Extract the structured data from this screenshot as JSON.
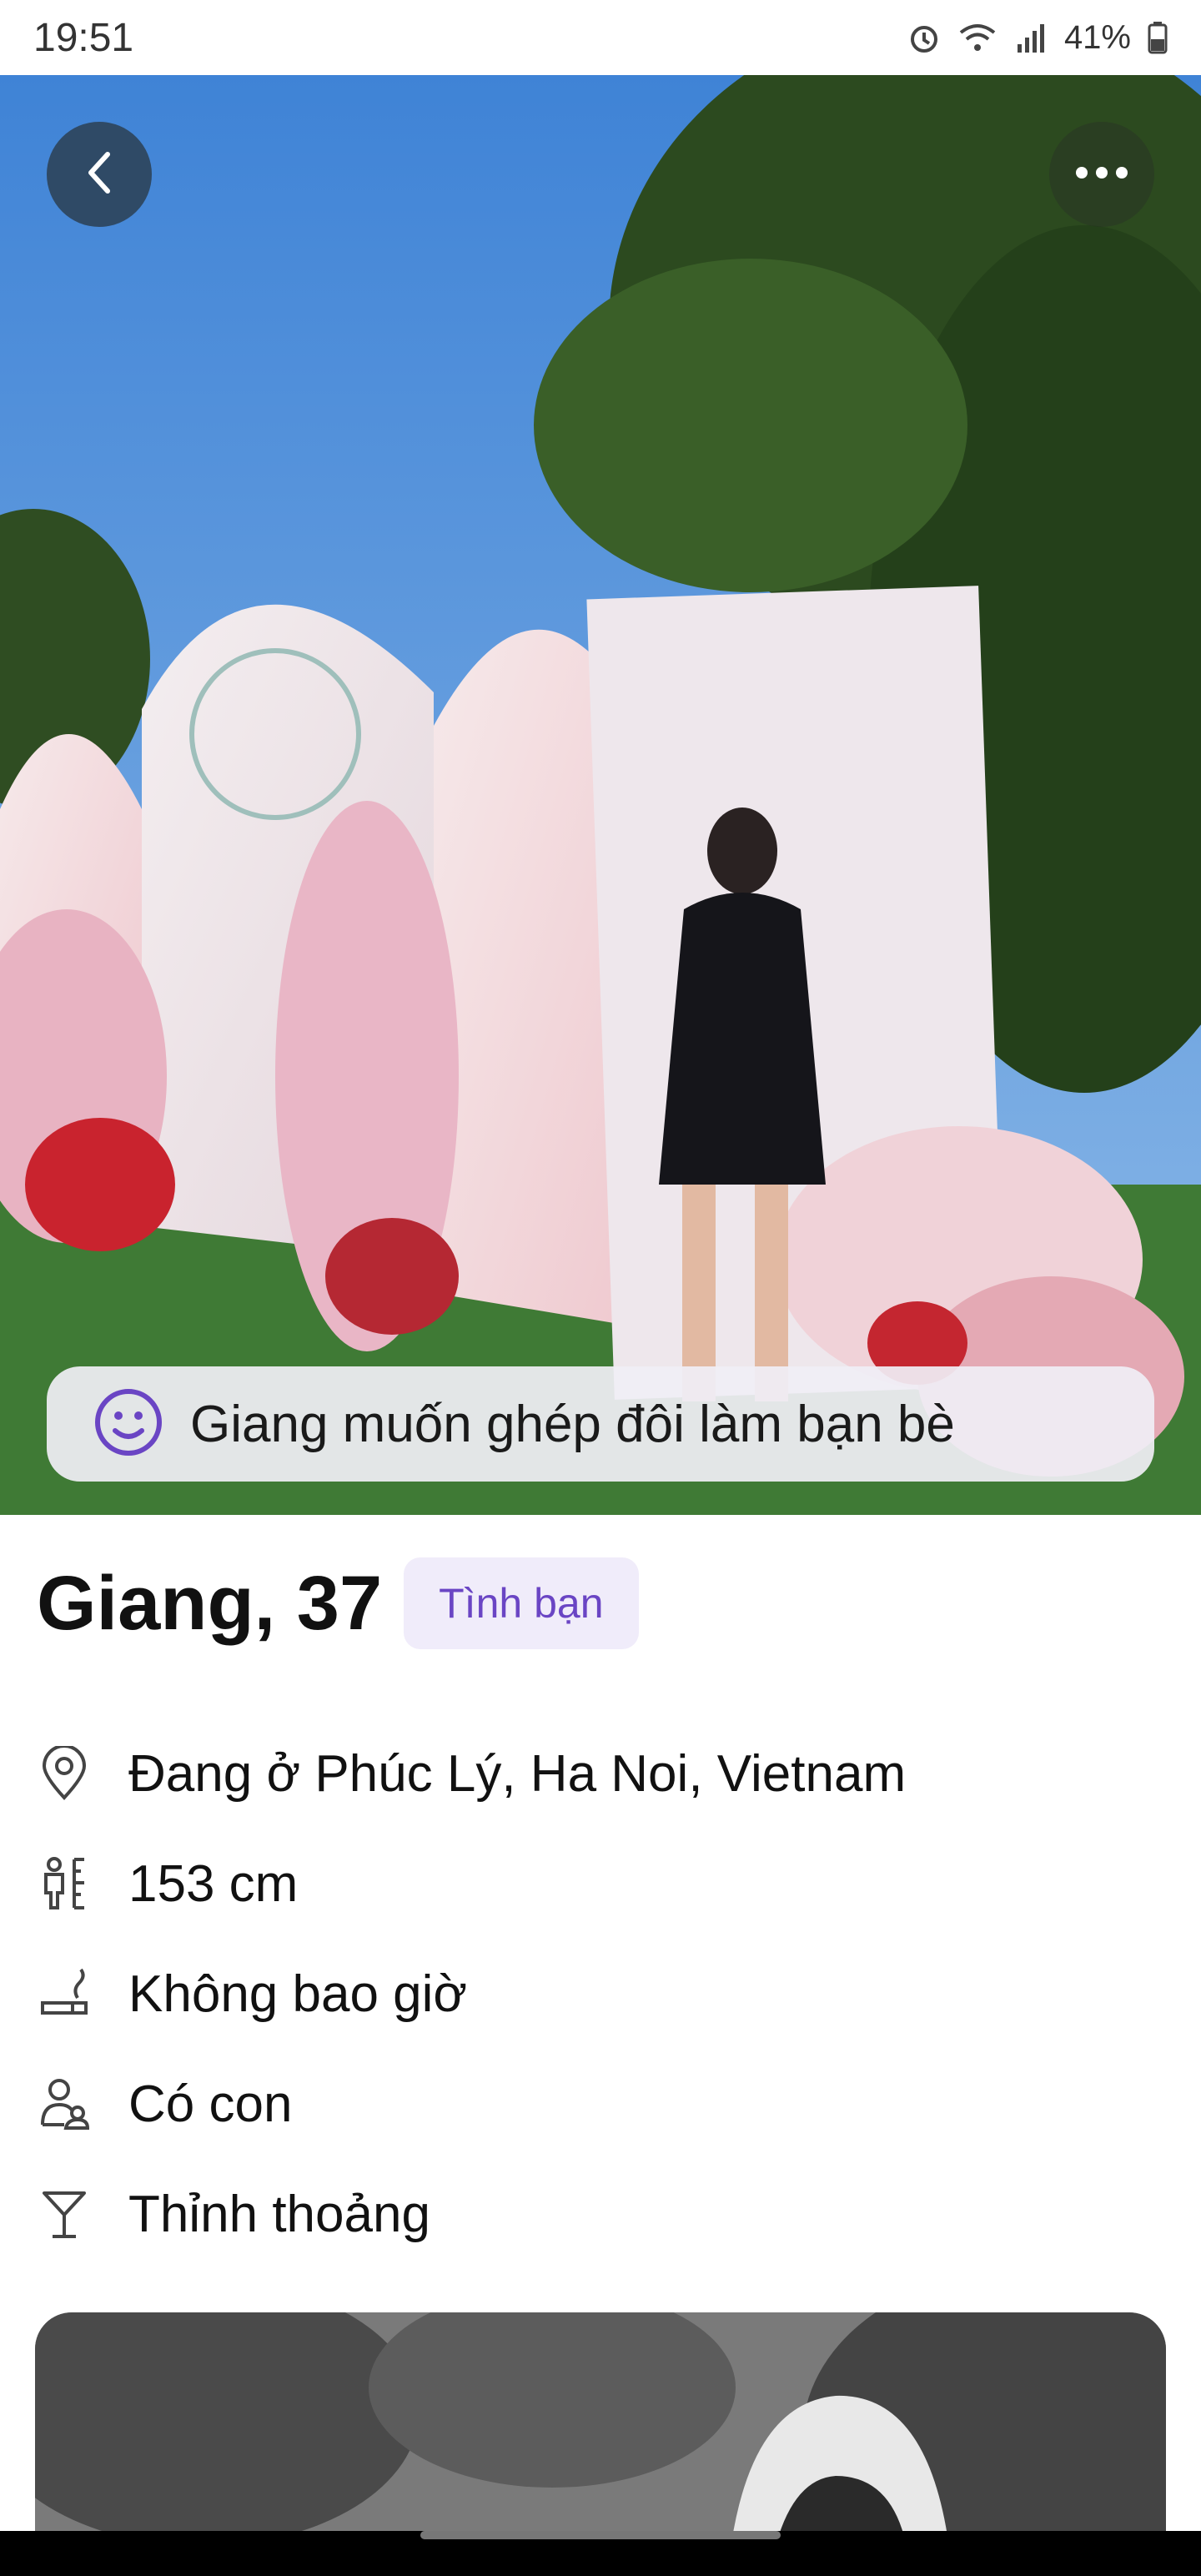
{
  "status_bar": {
    "time": "19:51",
    "battery": "41%"
  },
  "hero": {
    "back_icon": "chevron-left-icon",
    "more_icon": "more-horizontal-icon",
    "intent_icon": "smiley-icon",
    "intent_text": "Giang muốn ghép đôi làm bạn bè"
  },
  "profile": {
    "name_age": "Giang, 37",
    "intent_tag": "Tình bạn",
    "details": [
      {
        "icon": "location-pin-icon",
        "label": "Đang ở Phúc Lý, Ha Noi, Vietnam"
      },
      {
        "icon": "height-icon",
        "label": "153 cm"
      },
      {
        "icon": "smoking-icon",
        "label": "Không bao giờ"
      },
      {
        "icon": "children-icon",
        "label": "Có con"
      },
      {
        "icon": "drink-icon",
        "label": "Thỉnh thoảng"
      }
    ]
  },
  "colors": {
    "accent": "#6a45c4",
    "tag_bg": "#f0ecfa",
    "back_button": "#2f4a66"
  }
}
